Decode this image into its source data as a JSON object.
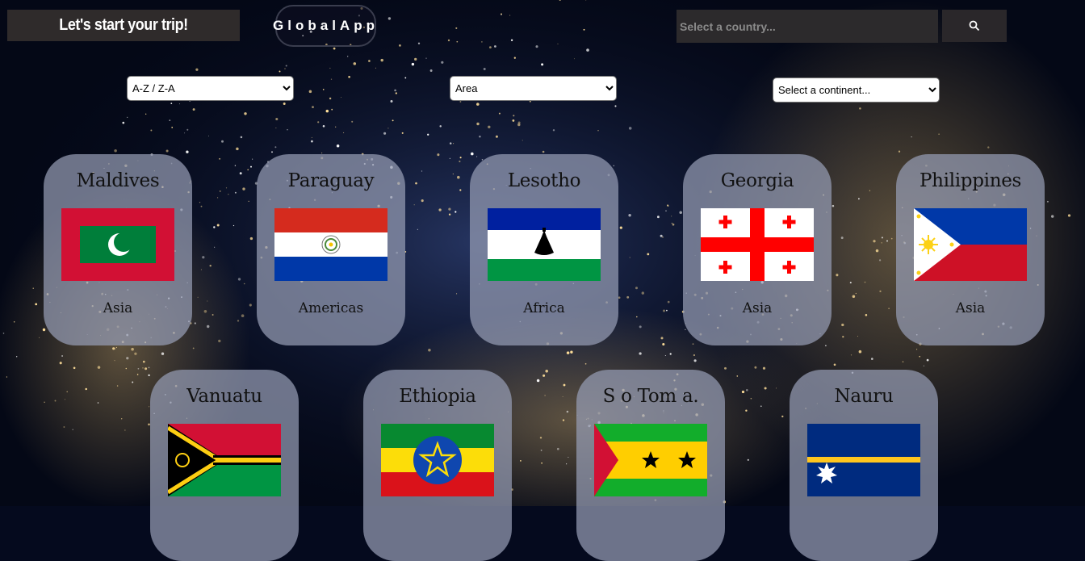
{
  "header": {
    "title": "Let's start your trip!",
    "brand": "GlobalApp",
    "search_placeholder": "Select a country...",
    "search_icon": "search-icon"
  },
  "filters": {
    "sort": "A-Z / Z-A",
    "measure": "Area",
    "continent": "Select a continent..."
  },
  "countries": [
    {
      "name": "Maldives",
      "continent": "Asia",
      "flag": "maldives-flag"
    },
    {
      "name": "Paraguay",
      "continent": "Americas",
      "flag": "paraguay-flag"
    },
    {
      "name": "Lesotho",
      "continent": "Africa",
      "flag": "lesotho-flag"
    },
    {
      "name": "Georgia",
      "continent": "Asia",
      "flag": "georgia-flag"
    },
    {
      "name": "Philippines",
      "continent": "Asia",
      "flag": "philippines-flag"
    },
    {
      "name": "Vanuatu",
      "continent": "",
      "flag": "vanuatu-flag"
    },
    {
      "name": "Ethiopia",
      "continent": "",
      "flag": "ethiopia-flag"
    },
    {
      "name": "S o Tom a.",
      "continent": "",
      "flag": "sao-tome-flag"
    },
    {
      "name": "Nauru",
      "continent": "",
      "flag": "nauru-flag"
    }
  ],
  "colors": {
    "card_bg": "#969cb4",
    "header_bg": "#2f2b2b",
    "page_bg": "#050a1e"
  }
}
